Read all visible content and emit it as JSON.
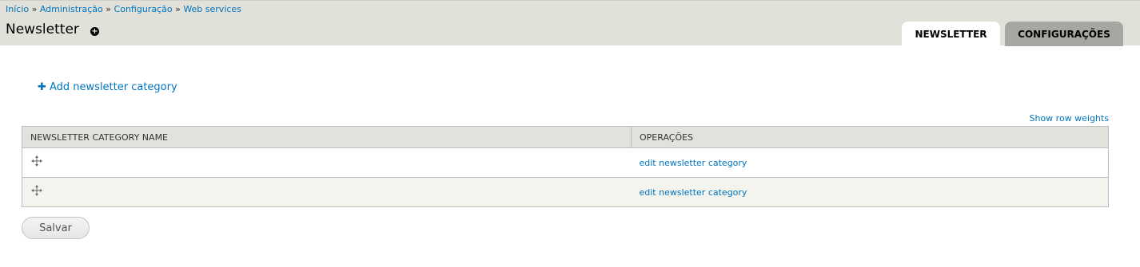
{
  "breadcrumb": {
    "items": [
      "Início",
      "Administração",
      "Configuração",
      "Web services"
    ],
    "separator": "»"
  },
  "page": {
    "title": "Newsletter",
    "shortcut_icon": "add-shortcut-icon"
  },
  "tabs": [
    {
      "label": "NEWSLETTER",
      "active": true
    },
    {
      "label": "CONFIGURAÇÕES",
      "active": false
    }
  ],
  "actions": {
    "add_category_label": "Add newsletter category",
    "add_icon": "plus-icon"
  },
  "table": {
    "show_row_weights_label": "Show row weights",
    "columns": [
      "NEWSLETTER CATEGORY NAME",
      "OPERAÇÕES"
    ],
    "rows": [
      {
        "name": "",
        "operation": "edit newsletter category",
        "drag_icon": "drag-handle-icon"
      },
      {
        "name": "",
        "operation": "edit newsletter category",
        "drag_icon": "drag-handle-icon"
      }
    ]
  },
  "form": {
    "save_label": "Salvar"
  },
  "colors": {
    "link": "#0074bd",
    "header_bg": "#e1e0d9",
    "inactive_tab_bg": "#a6a7a2",
    "table_header_bg": "#e1e2dc",
    "even_row_bg": "#f3f4ee"
  }
}
